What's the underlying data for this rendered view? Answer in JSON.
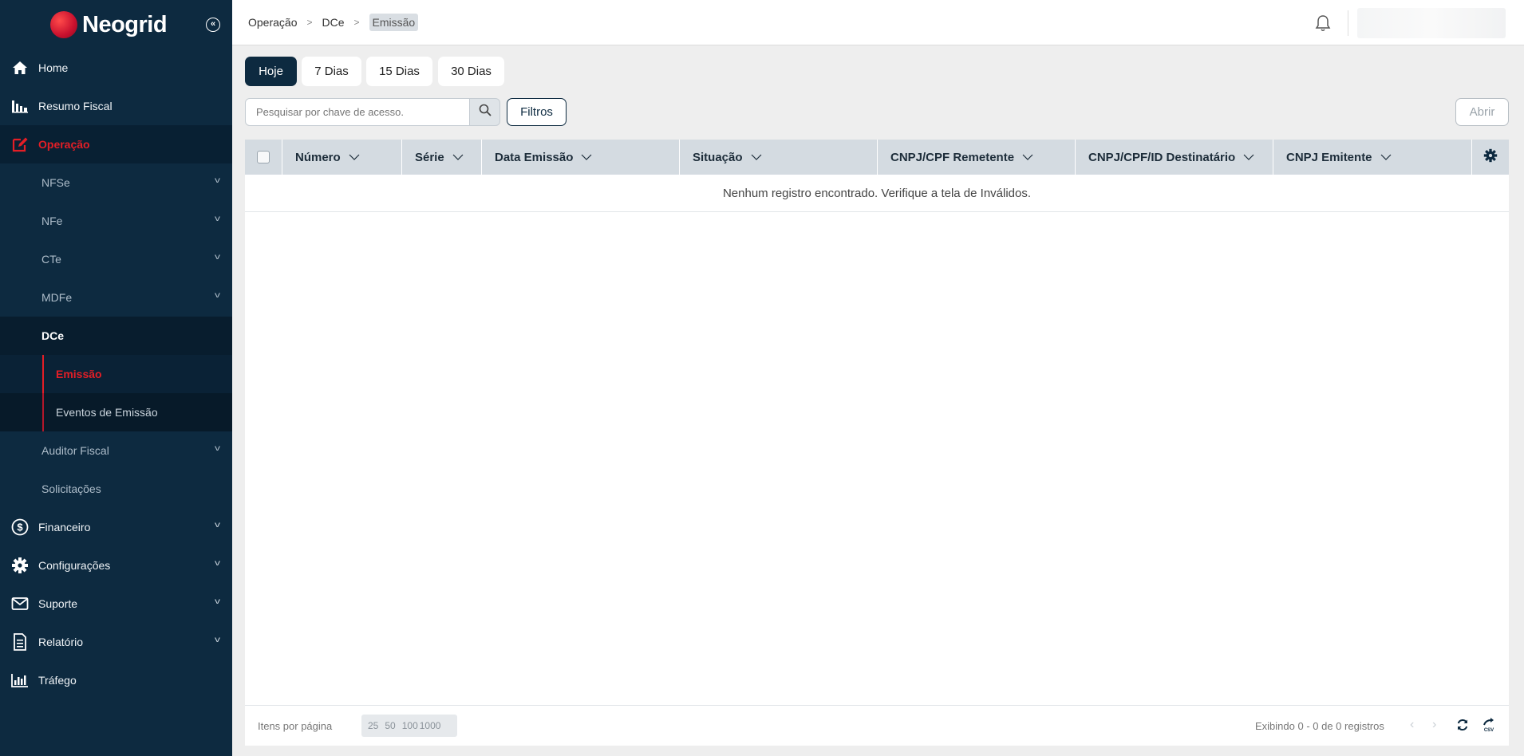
{
  "brand": {
    "name": "Neogrid"
  },
  "sidebar": {
    "items": [
      {
        "label": "Home",
        "icon": "home-icon"
      },
      {
        "label": "Resumo Fiscal",
        "icon": "bar-chart-icon"
      },
      {
        "label": "Operação",
        "icon": "edit-icon",
        "active": true
      },
      {
        "label": "Financeiro",
        "icon": "dollar-circle-icon"
      },
      {
        "label": "Configurações",
        "icon": "gear-icon"
      },
      {
        "label": "Suporte",
        "icon": "envelope-icon"
      },
      {
        "label": "Relatório",
        "icon": "document-icon"
      },
      {
        "label": "Tráfego",
        "icon": "traffic-chart-icon"
      }
    ],
    "operacao_sub": [
      {
        "label": "NFSe"
      },
      {
        "label": "NFe"
      },
      {
        "label": "CTe"
      },
      {
        "label": "MDFe"
      },
      {
        "label": "DCe"
      },
      {
        "label": "Auditor Fiscal"
      },
      {
        "label": "Solicitações"
      }
    ],
    "dce_sub": [
      {
        "label": "Emissão",
        "active": true
      },
      {
        "label": "Eventos de Emissão"
      }
    ]
  },
  "header": {
    "breadcrumb": [
      "Operação",
      "DCe",
      "Emissão"
    ]
  },
  "date_tabs": [
    {
      "label": "Hoje",
      "active": true
    },
    {
      "label": "7 Dias"
    },
    {
      "label": "15 Dias"
    },
    {
      "label": "30 Dias"
    }
  ],
  "search": {
    "placeholder": "Pesquisar por chave de acesso."
  },
  "toolbar": {
    "filters_label": "Filtros",
    "open_label": "Abrir"
  },
  "grid": {
    "columns": [
      "Número",
      "Série",
      "Data Emissão",
      "Situação",
      "CNPJ/CPF Remetente",
      "CNPJ/CPF/ID Destinatário",
      "CNPJ Emitente"
    ],
    "empty_message": "Nenhum registro encontrado. Verifique a tela de Inválidos."
  },
  "footer": {
    "per_page_label": "Itens por página",
    "page_sizes": [
      "25",
      "50",
      "100",
      "1000"
    ],
    "display_info": "Exibindo  0 - 0 de 0 registros"
  },
  "colors": {
    "sidebar_bg": "#0d2a40",
    "accent_red": "#e31e26",
    "header_grid_bg": "#d4dbe1"
  }
}
